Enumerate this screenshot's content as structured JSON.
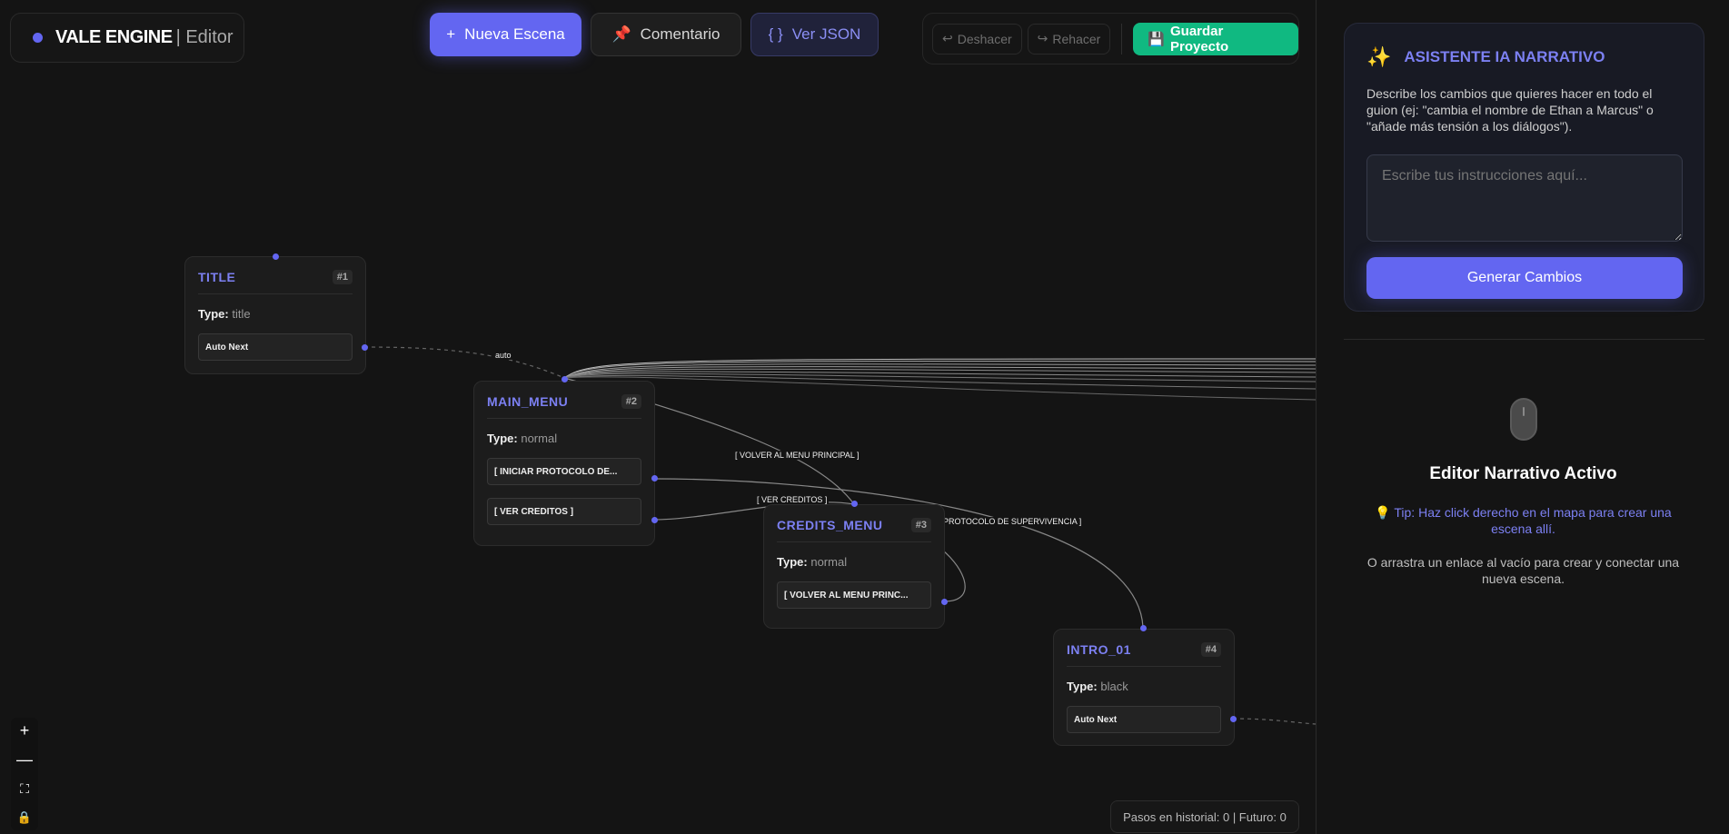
{
  "brand": {
    "name": "VALE ENGINE",
    "sub": "| Editor"
  },
  "toolbar": {
    "new_scene": "Nueva Escena",
    "comment": "Comentario",
    "json": "Ver JSON",
    "undo": "Deshacer",
    "redo": "Rehacer",
    "save": "Guardar Proyecto"
  },
  "nodes": [
    {
      "title": "TITLE",
      "id": "#1",
      "type_label": "Type:",
      "type": "title",
      "options": [
        "Auto Next"
      ]
    },
    {
      "title": "MAIN_MENU",
      "id": "#2",
      "type_label": "Type:",
      "type": "normal",
      "options": [
        "[ INICIAR PROTOCOLO DE...",
        "[ VER CREDITOS ]"
      ]
    },
    {
      "title": "CREDITS_MENU",
      "id": "#3",
      "type_label": "Type:",
      "type": "normal",
      "options": [
        "[ VOLVER AL MENU PRINC..."
      ]
    },
    {
      "title": "INTRO_01",
      "id": "#4",
      "type_label": "Type:",
      "type": "black",
      "options": [
        "Auto Next"
      ]
    }
  ],
  "edge_labels": {
    "auto": "auto",
    "volver": "[ VOLVER AL MENU PRINCIPAL ]",
    "creditos": "[ VER CREDITOS ]",
    "protocolo": "PROTOCOLO DE SUPERVIVENCIA ]"
  },
  "status": "Pasos en historial: 0 | Futuro: 0",
  "assistant": {
    "title": "ASISTENTE IA NARRATIVO",
    "description": "Describe los cambios que quieres hacer en todo el guion (ej: \"cambia el nombre de Ethan a Marcus\" o \"añade más tensión a los diálogos\").",
    "placeholder": "Escribe tus instrucciones aquí...",
    "generate": "Generar Cambios"
  },
  "editor": {
    "title": "Editor Narrativo Activo",
    "tip": "Tip: Haz click derecho en el mapa para crear una escena allí.",
    "hint": "O arrastra un enlace al vacío para crear y conectar una nueva escena."
  },
  "colors": {
    "accent": "#6366f1",
    "save": "#10b981",
    "background": "#141414"
  }
}
